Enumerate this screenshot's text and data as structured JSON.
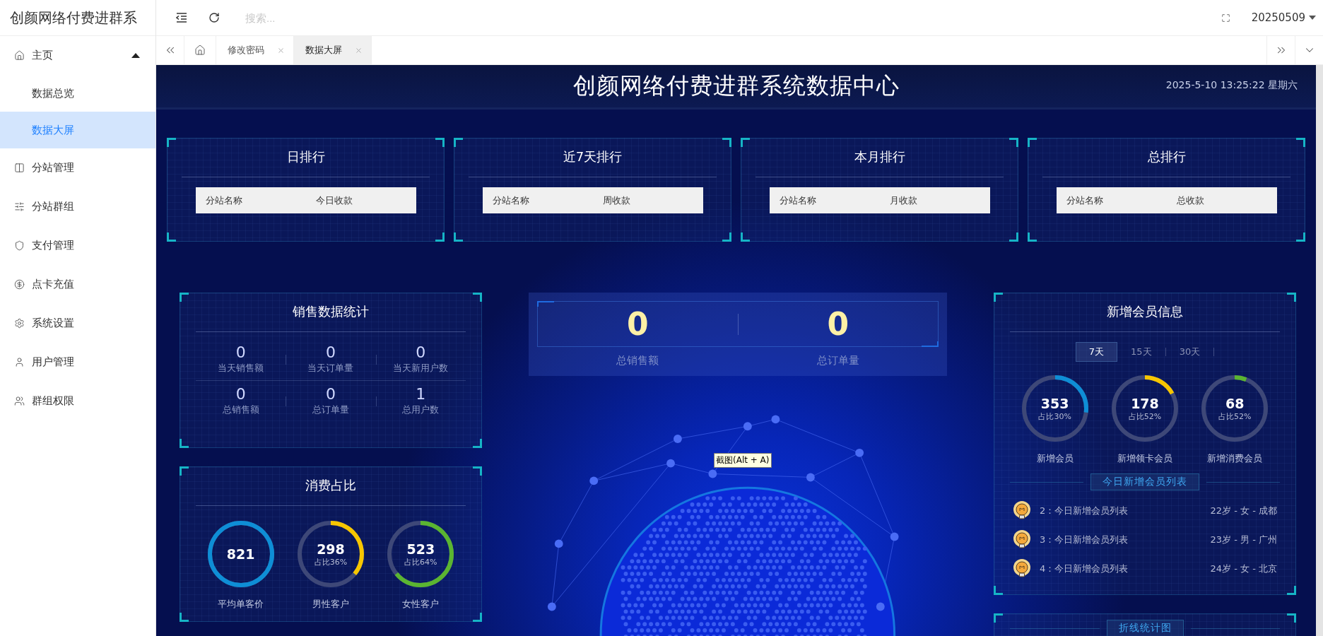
{
  "sidebar": {
    "title": "创颜网络付费进群系",
    "items": [
      {
        "label": "主页",
        "selected": false,
        "expanded": true,
        "children": [
          {
            "label": "数据总览",
            "selected": false
          },
          {
            "label": "数据大屏",
            "selected": true
          }
        ]
      },
      {
        "label": "分站管理",
        "selected": false
      },
      {
        "label": "分站群组",
        "selected": false
      },
      {
        "label": "支付管理",
        "selected": false
      },
      {
        "label": "点卡充值",
        "selected": false
      },
      {
        "label": "系统设置",
        "selected": false
      },
      {
        "label": "用户管理",
        "selected": false
      },
      {
        "label": "群组权限",
        "selected": false
      }
    ]
  },
  "header": {
    "search": {
      "placeholder": "搜索..."
    },
    "user": "20250509"
  },
  "tabs": [
    {
      "label": "修改密码",
      "selected": false
    },
    {
      "label": "数据大屏",
      "selected": true
    }
  ],
  "dashboard": {
    "title": "创颜网络付费进群系统数据中心",
    "datetime": "2025-5-10 13:25:22 星期六",
    "rankings": [
      {
        "title": "日排行",
        "columns": [
          "分站名称",
          "今日收款"
        ]
      },
      {
        "title": "近7天排行",
        "columns": [
          "分站名称",
          "周收款"
        ]
      },
      {
        "title": "本月排行",
        "columns": [
          "分站名称",
          "月收款"
        ]
      },
      {
        "title": "总排行",
        "columns": [
          "分站名称",
          "总收款"
        ]
      }
    ],
    "sales": {
      "title": "销售数据统计",
      "stats": [
        {
          "value": "0",
          "label": "当天销售额"
        },
        {
          "value": "0",
          "label": "当天订单量"
        },
        {
          "value": "0",
          "label": "当天新用户数"
        },
        {
          "value": "0",
          "label": "总销售额"
        },
        {
          "value": "0",
          "label": "总订单量"
        },
        {
          "value": "1",
          "label": "总用户数"
        }
      ]
    },
    "consumption": {
      "title": "消费占比",
      "rings": [
        {
          "value": "821",
          "label": "平均单客价",
          "color": "#0e8ed6",
          "level": 1
        },
        {
          "value": "298",
          "share": "占比36%",
          "label": "男性客户",
          "color": "#f7c600",
          "level": 0.36
        },
        {
          "value": "523",
          "share": "占比64%",
          "label": "女性客户",
          "color": "#5bb531",
          "level": 0.64
        }
      ]
    },
    "totals": [
      {
        "value": "0",
        "label": "总销售额"
      },
      {
        "value": "0",
        "label": "总订单量"
      }
    ],
    "tooltip": "截图(Alt + A)",
    "members": {
      "title": "新增会员信息",
      "periods": [
        {
          "label": "7天",
          "selected": true
        },
        {
          "label": "15天",
          "selected": false
        },
        {
          "label": "30天",
          "selected": false
        }
      ],
      "rings": [
        {
          "value": "353",
          "share": "占比30%",
          "label": "新增会员",
          "color": "#0e8ed6",
          "level": 0.27
        },
        {
          "value": "178",
          "share": "占比52%",
          "label": "新增领卡会员",
          "color": "#f7c600",
          "level": 0.17
        },
        {
          "value": "68",
          "share": "占比52%",
          "label": "新增消费会员",
          "color": "#5bb531",
          "level": 0.06
        }
      ],
      "list_title": "今日新增会员列表",
      "list": [
        {
          "name": "2：今日新增会员列表",
          "info": "22岁 - 女 - 成都"
        },
        {
          "name": "3：今日新增会员列表",
          "info": "23岁 - 男 - 广州"
        },
        {
          "name": "4：今日新增会员列表",
          "info": "24岁 - 女 - 北京"
        }
      ]
    },
    "line_chart": {
      "title": "折线统计图"
    }
  }
}
